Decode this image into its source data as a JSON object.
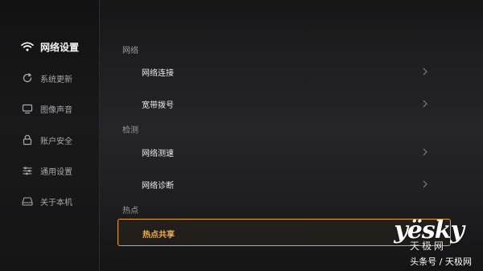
{
  "sidebar": {
    "items": [
      {
        "label": "网络设置",
        "icon": "wifi-icon",
        "active": true
      },
      {
        "label": "系统更新",
        "icon": "refresh-icon",
        "active": false
      },
      {
        "label": "图像声音",
        "icon": "monitor-icon",
        "active": false
      },
      {
        "label": "账户安全",
        "icon": "lock-icon",
        "active": false
      },
      {
        "label": "通用设置",
        "icon": "sliders-icon",
        "active": false
      },
      {
        "label": "关于本机",
        "icon": "device-icon",
        "active": false
      }
    ]
  },
  "main": {
    "sections": [
      {
        "title": "网络",
        "rows": [
          {
            "label": "网络连接",
            "icon": "chevron-right-icon"
          },
          {
            "label": "宽带拨号",
            "icon": "chevron-right-icon"
          }
        ]
      },
      {
        "title": "检测",
        "rows": [
          {
            "label": "网络测速",
            "icon": "chevron-right-icon"
          },
          {
            "label": "网络诊断",
            "icon": "chevron-right-icon"
          }
        ]
      },
      {
        "title": "热点",
        "rows": [
          {
            "label": "热点共享",
            "focused": true
          }
        ]
      }
    ]
  },
  "watermark": {
    "logo": "yësky",
    "subtitle": "天极网",
    "caption": "头条号 / 天极网"
  },
  "colors": {
    "background": "#1e1e20",
    "sidebar": "#151516",
    "accent": "#e9a23b",
    "text_primary": "#ececec",
    "text_secondary": "#a9a9ab"
  }
}
